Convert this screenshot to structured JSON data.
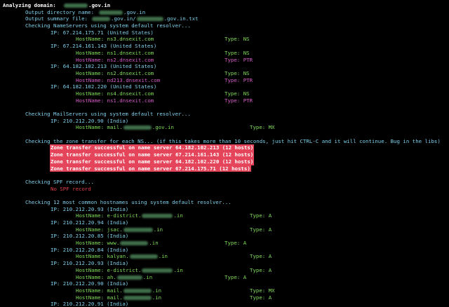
{
  "colors": {
    "background": "#000000",
    "heading": "#ffffff",
    "info": "#7fd0ec",
    "hostname": "#7fdc5a",
    "ptr": "#d65cc8",
    "no_spf": "#e0414d",
    "alert_bg": "#e4455a"
  },
  "header": {
    "analyzing_label": "Analyzing domain:",
    "domain_suffix": ".gov.in",
    "output_dir_label": "Output directory name:",
    "output_dir_suffix": ".gov.in",
    "summary_file_label": "Output summary file:",
    "summary_file_mid": ".gov.in/",
    "summary_file_suffix": ".gov.in.txt"
  },
  "nameservers": {
    "heading": "Checking NameServers using system default resolver...",
    "entries": [
      {
        "ip": "IP: 67.214.175.71 (United States)",
        "records": [
          {
            "host": "HostName: ns3.dnsexit.com",
            "type": "Type: NS"
          }
        ]
      },
      {
        "ip": "IP: 67.214.161.143 (United States)",
        "records": [
          {
            "host": "HostName: ns1.dnsexit.com",
            "type": "Type: NS"
          },
          {
            "host": "HostName: ns2.dnsexit.com",
            "type": "Type: PTR"
          }
        ]
      },
      {
        "ip": "IP: 64.182.102.213 (United States)",
        "records": [
          {
            "host": "HostName: ns2.dnsexit.com",
            "type": "Type: NS"
          },
          {
            "host": "HostName: nd213.dnsexit.com",
            "type": "Type: PTR"
          }
        ]
      },
      {
        "ip": "IP: 64.182.102.220 (United States)",
        "records": [
          {
            "host": "HostName: ns4.dnsexit.com",
            "type": "Type: NS"
          },
          {
            "host": "HostName: ns1.dnsexit.com",
            "type": "Type: PTR"
          }
        ]
      }
    ]
  },
  "mailservers": {
    "heading": "Checking MailServers using system default resolver...",
    "ip": "IP: 210.212.20.90 (India)",
    "host_prefix": "HostName: mail.",
    "host_suffix": ".gov.in",
    "type": "Type: MX"
  },
  "zone_transfer": {
    "heading": "Checking the zone transfer for each NS... (if this takes more than 10 seconds, just hit CTRL-C and it will continue. Bug in the libs)",
    "results": [
      "Zone transfer successful on name server 64.182.102.213 (12 hosts)",
      "Zone transfer successful on name server 67.214.161.143 (12 hosts)",
      "Zone transfer successful on name server 64.182.102.220 (12 hosts)",
      "Zone transfer successful on name server 67.214.175.71 (12 hosts)"
    ]
  },
  "spf": {
    "heading": "Checking SPF record...",
    "result": "No SPF record"
  },
  "hostnames": {
    "heading": "Checking 12 most common hostnames using system default resolver...",
    "entries": [
      {
        "ip": "IP: 210.212.20.93 (India)",
        "host_prefix": "HostName: e-district.",
        "host_suffix": ".in",
        "type": "Type: A",
        "type_col": "wide"
      },
      {
        "ip": "IP: 210.212.20.94 (India)",
        "host_prefix": "HostName: jsac.",
        "host_suffix": ".in",
        "type": "Type: A",
        "type_col": "wide"
      },
      {
        "ip": "IP: 210.212.20.85 (India)",
        "host_prefix": "HostName: www.",
        "host_suffix": ".in",
        "type": "Type: A",
        "type_col": "narrow"
      },
      {
        "ip": "IP: 210.212.20.84 (India)",
        "host_prefix": "HostName: kalyan.",
        "host_suffix": ".in",
        "type": "Type: A",
        "type_col": "wide"
      },
      {
        "ip": "IP: 210.212.20.93 (India)",
        "host_prefix": "HostName: e-district.",
        "host_suffix": ".in",
        "type": "Type: A",
        "type_col": "wide"
      },
      {
        "ip": null,
        "host_prefix": "HostName: ah.",
        "host_suffix": ".in",
        "type": "Type: A",
        "type_col": "narrow"
      },
      {
        "ip": "IP: 210.212.20.90 (India)",
        "host_prefix": "HostName: mail.",
        "host_suffix": ".in",
        "type": "Type: MX",
        "type_col": "wide"
      },
      {
        "ip": null,
        "host_prefix": "HostName: mail.",
        "host_suffix": ".in",
        "type": "Type: A",
        "type_col": "wide"
      },
      {
        "ip": "IP: 210.212.20.91 (India)",
        "host_prefix": null,
        "host_suffix": null,
        "type": null,
        "type_col": null
      }
    ]
  }
}
